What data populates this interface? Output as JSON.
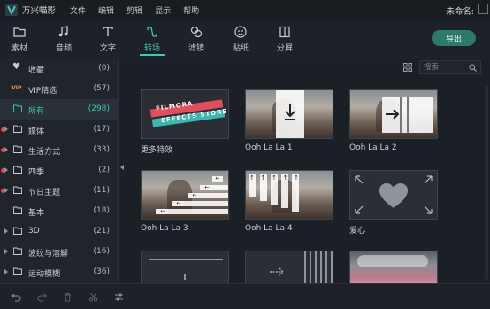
{
  "titlebar": {
    "app_name": "万兴喵影",
    "menu": [
      "文件",
      "编辑",
      "剪辑",
      "显示",
      "帮助"
    ],
    "doc_name": "未命名:"
  },
  "toolbar": {
    "tools": [
      {
        "label": "素材",
        "icon": "media-folder-icon"
      },
      {
        "label": "音频",
        "icon": "music-note-icon"
      },
      {
        "label": "文字",
        "icon": "text-icon"
      },
      {
        "label": "转场",
        "icon": "transition-icon",
        "active": true
      },
      {
        "label": "滤镜",
        "icon": "filter-icon"
      },
      {
        "label": "贴纸",
        "icon": "sticker-icon"
      },
      {
        "label": "分屏",
        "icon": "split-screen-icon"
      }
    ],
    "export_label": "导出"
  },
  "sidebar": {
    "items": [
      {
        "name": "收藏",
        "count": "(0)"
      },
      {
        "name": "VIP精选",
        "count": "(57)"
      },
      {
        "name": "所有",
        "count": "(298)"
      },
      {
        "name": "媒体",
        "count": "(17)"
      },
      {
        "name": "生活方式",
        "count": "(33)"
      },
      {
        "name": "四季",
        "count": "(2)"
      },
      {
        "name": "节日主题",
        "count": "(11)"
      },
      {
        "name": "基本",
        "count": "(18)"
      },
      {
        "name": "3D",
        "count": "(21)"
      },
      {
        "name": "波纹与溶解",
        "count": "(16)"
      },
      {
        "name": "运动模糊",
        "count": "(36)"
      }
    ]
  },
  "search": {
    "placeholder": "搜索"
  },
  "thumb_banner": {
    "line1": "FILMORA",
    "line2": "EFFECTS STORE"
  },
  "grid": {
    "items": [
      {
        "caption": "更多特效"
      },
      {
        "caption": "Ooh La La 1"
      },
      {
        "caption": "Ooh La La 2"
      },
      {
        "caption": "Ooh La La 3"
      },
      {
        "caption": "Ooh La La 4"
      },
      {
        "caption": "爱心"
      }
    ]
  },
  "colors": {
    "accent": "#3ec9b5",
    "export_button": "#2c7a6a",
    "badge_dot": "#e0464a",
    "vip": "#e8a03a",
    "background": "#1b2026"
  }
}
